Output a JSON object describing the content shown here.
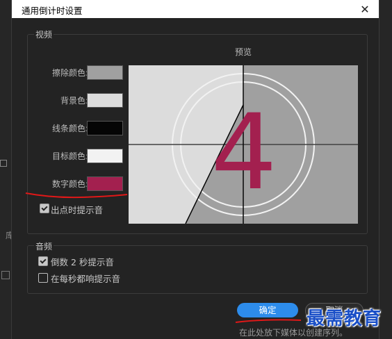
{
  "dialog": {
    "title": "通用倒计时设置",
    "close_icon": "close-icon"
  },
  "video": {
    "group_title": "视频",
    "preview_label": "预览",
    "colors": [
      {
        "label": "擦除颜色:",
        "color": "#a0a0a0"
      },
      {
        "label": "背景色:",
        "color": "#dcdcdc"
      },
      {
        "label": "线条颜色:",
        "color": "#050505"
      },
      {
        "label": "目标颜色:",
        "color": "#f2f2f2"
      },
      {
        "label": "数字颜色:",
        "color": "#a3204f"
      }
    ],
    "cue_checkbox": {
      "label": "出点时提示音",
      "checked": true
    },
    "preview_digit": "4"
  },
  "audio": {
    "group_title": "音频",
    "options": [
      {
        "label": "倒数 2 秒提示音",
        "checked": true
      },
      {
        "label": "在每秒都响提示音",
        "checked": false
      }
    ]
  },
  "buttons": {
    "ok": "确定",
    "cancel": "取消"
  },
  "host": {
    "left_label": "库",
    "footer": "在此处放下媒体以创建序列。"
  },
  "watermark": "最需教育",
  "accent_colors": {
    "primary_button": "#2d8ceb",
    "annotation": "#e01818"
  }
}
